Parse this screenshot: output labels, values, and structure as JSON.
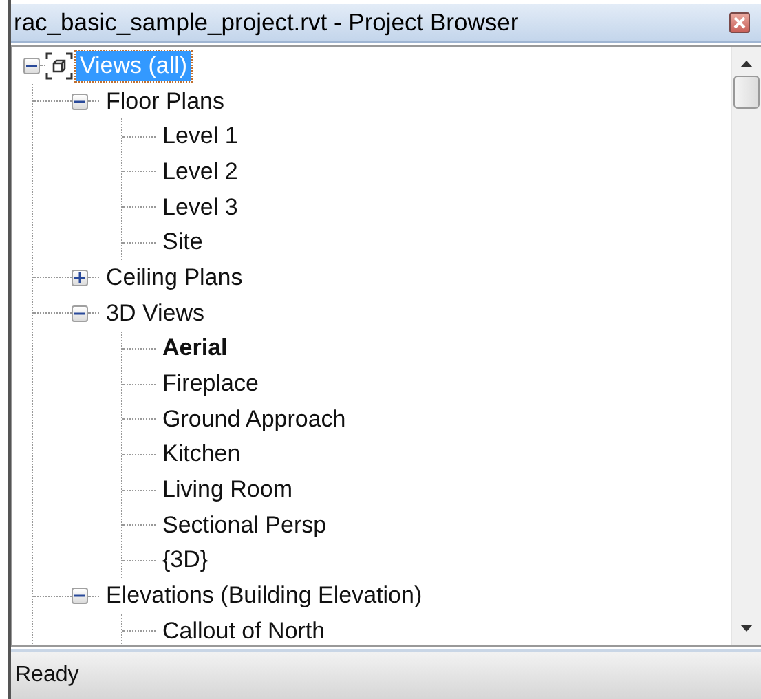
{
  "window": {
    "title": "rac_basic_sample_project.rvt - Project Browser"
  },
  "tree": [
    {
      "label": "Views (all)",
      "kind": "root",
      "expanded": true,
      "selected": true,
      "current": false,
      "children": [
        {
          "label": "Floor Plans",
          "expanded": true,
          "selected": false,
          "current": false,
          "children": [
            {
              "label": "Level 1",
              "selected": false,
              "current": false
            },
            {
              "label": "Level 2",
              "selected": false,
              "current": false
            },
            {
              "label": "Level 3",
              "selected": false,
              "current": false
            },
            {
              "label": "Site",
              "selected": false,
              "current": false
            }
          ]
        },
        {
          "label": "Ceiling Plans",
          "expanded": false,
          "selected": false,
          "current": false
        },
        {
          "label": "3D Views",
          "expanded": true,
          "selected": false,
          "current": false,
          "children": [
            {
              "label": "Aerial",
              "selected": false,
              "current": true
            },
            {
              "label": "Fireplace",
              "selected": false,
              "current": false
            },
            {
              "label": "Ground Approach",
              "selected": false,
              "current": false
            },
            {
              "label": "Kitchen",
              "selected": false,
              "current": false
            },
            {
              "label": "Living Room",
              "selected": false,
              "current": false
            },
            {
              "label": "Sectional Persp",
              "selected": false,
              "current": false
            },
            {
              "label": "{3D}",
              "selected": false,
              "current": false
            }
          ]
        },
        {
          "label": "Elevations (Building Elevation)",
          "expanded": true,
          "selected": false,
          "current": false,
          "children": [
            {
              "label": "Callout of North",
              "selected": false,
              "current": false
            }
          ]
        }
      ]
    }
  ],
  "status_bar": {
    "text": "Ready"
  }
}
